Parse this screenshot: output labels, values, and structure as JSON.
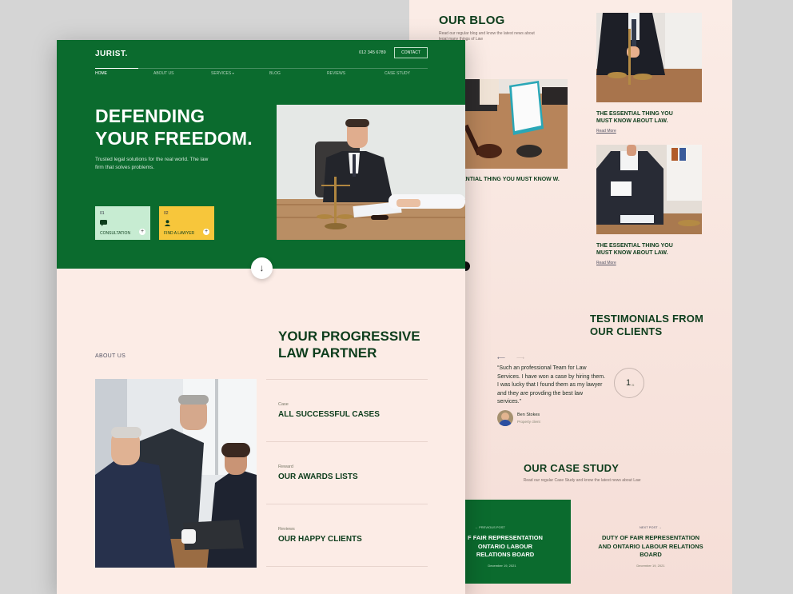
{
  "blog": {
    "title": "OUR BLOG",
    "subtitle": "Read our regular blog and know the latest news about legal many things of Law",
    "card1_title": "THE ESSENTIAL THING YOU MUST KNOW ABOUT LAW.",
    "card1_link": "Read More",
    "card2_title": "THE ESSENTIAL THING YOU MUST KNOW ABOUT LAW.",
    "card2_link": "Read More",
    "mid_title": "ENTIAL THING YOU MUST KNOW W."
  },
  "testimonials": {
    "title": "TESTIMONIALS FROM OUR CLIENTS",
    "quote": "“Such an professional Team for Law Services. I have won a case by hiring them. I was lucky that I found them as my lawyer and they are provding the best law services.”",
    "author": "Ben Stokes",
    "role": "Property client",
    "counter": "1",
    "counter_sub": "/5"
  },
  "case_study": {
    "title": "OUR CASE STUDY",
    "subtitle": "Read our regular Case Study and know the latest news about Law",
    "prev_label": "PREVIOUS POST",
    "prev_title": "F FAIR REPRESENTATION ONTARIO LABOUR RELATIONS BOARD",
    "prev_date": "December 19, 2021",
    "next_label": "NEXT POST",
    "next_title": "DUTY OF FAIR REPRESENTATION AND ONTARIO LABOUR RELATIONS BOARD",
    "next_date": "December 19, 2021"
  },
  "header": {
    "logo": "JURIST.",
    "phone": "012 345 6789",
    "contact": "CONTACT",
    "nav": [
      "HOME",
      "ABOUT US",
      "SERVICES",
      "BLOG",
      "REVIEWS",
      "CASE STUDY"
    ]
  },
  "hero": {
    "title_line1": "DEFENDING",
    "title_line2": "YOUR FREEDOM.",
    "subtitle": "Trusted legal solutions for the real world. The law firm that solves problems.",
    "cta1_num": "01",
    "cta1_label": "CONSULTATION",
    "cta2_num": "02",
    "cta2_label": "FIND A LAWYER",
    "plus": "+",
    "down_arrow": "↓"
  },
  "about": {
    "label": "ABOUT US",
    "title_line1": "YOUR PROGRESSIVE",
    "title_line2": "LAW PARTNER",
    "stats": [
      {
        "key": "Case",
        "value": "ALL SUCCESSFUL CASES"
      },
      {
        "key": "Reward",
        "value": "OUR AWARDS LISTS"
      },
      {
        "key": "Reviews",
        "value": "OUR HAPPY CLIENTS"
      }
    ]
  },
  "colors": {
    "brand_green": "#0b6b2e",
    "mint": "#c7ecd2",
    "yellow": "#f7c63b",
    "cream": "#fcece6"
  },
  "icons": [
    "chat-icon",
    "user-icon",
    "plus-icon",
    "arrow-down-icon",
    "arrow-left-icon",
    "arrow-right-icon",
    "chevron-down-icon"
  ]
}
